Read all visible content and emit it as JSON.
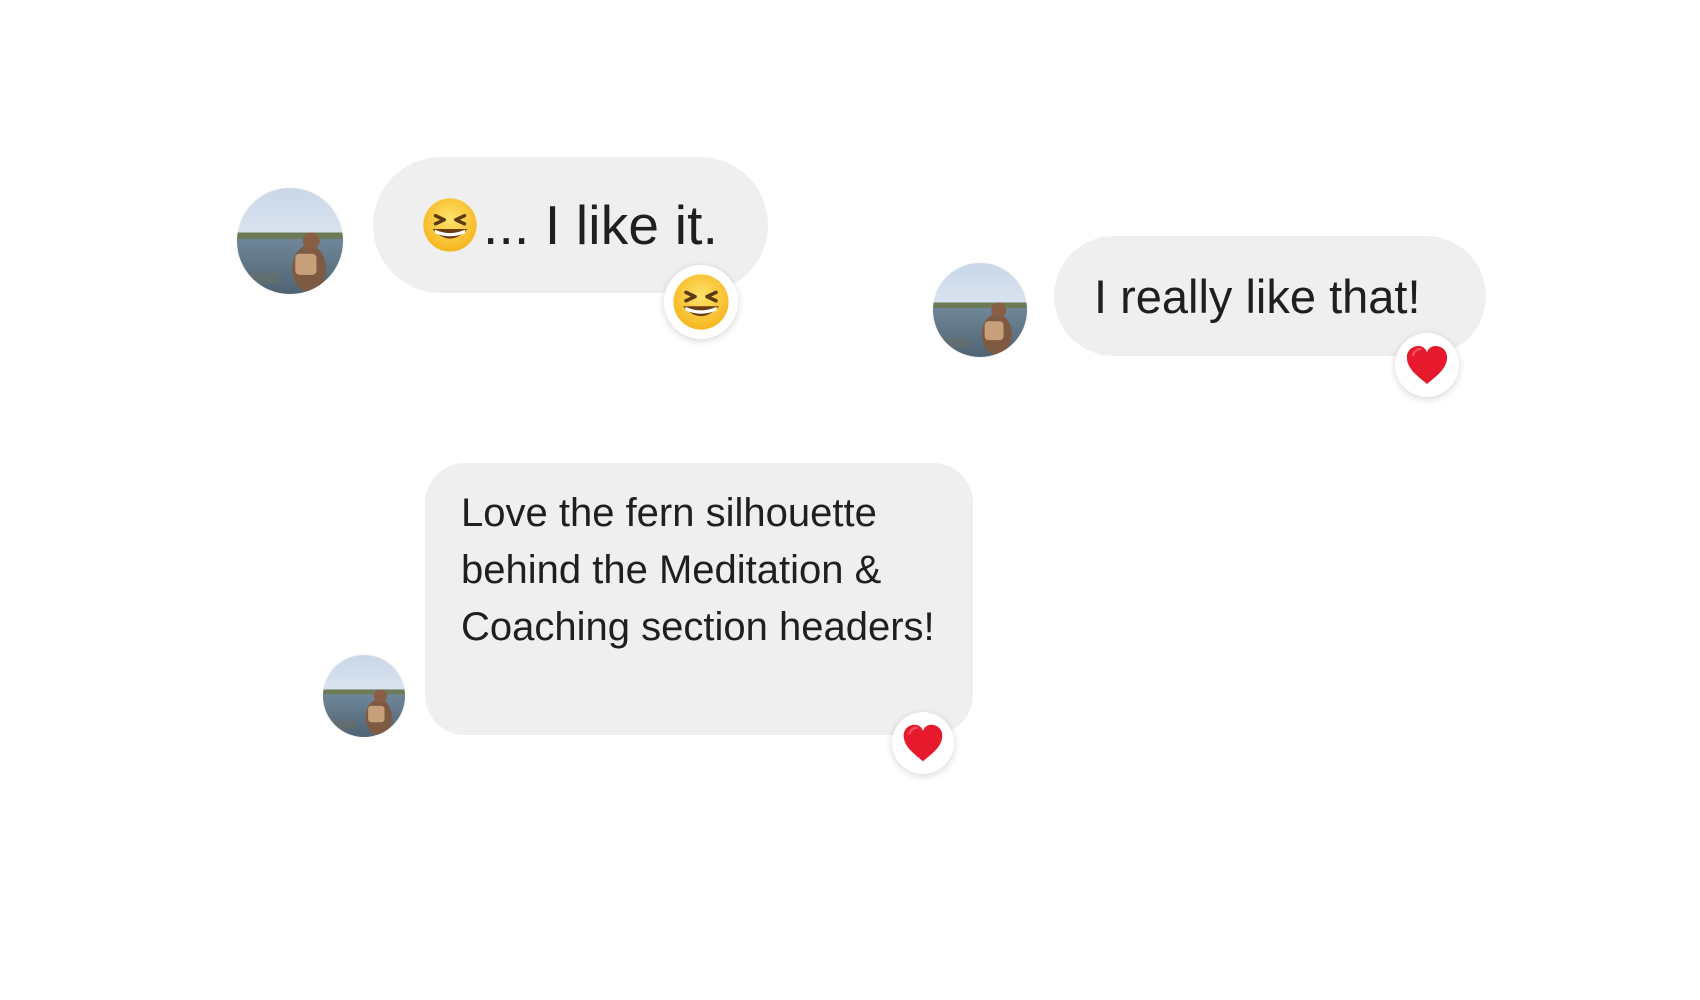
{
  "messages": [
    {
      "id": "m1",
      "emoji_prefix": "grinning-squinting-face",
      "text": "... I like it.",
      "reaction": "grinning-squinting-face"
    },
    {
      "id": "m2",
      "text": "I really like that!",
      "reaction": "red-heart"
    },
    {
      "id": "m3",
      "text": "Love the fern silhouette behind the Meditation & Coaching section headers!",
      "reaction": "red-heart"
    }
  ],
  "colors": {
    "background": "#ffffff",
    "bubble": "#efefef",
    "text": "#1f1f1f",
    "heart": "#e7192d",
    "emoji_face": "#ffc928"
  }
}
